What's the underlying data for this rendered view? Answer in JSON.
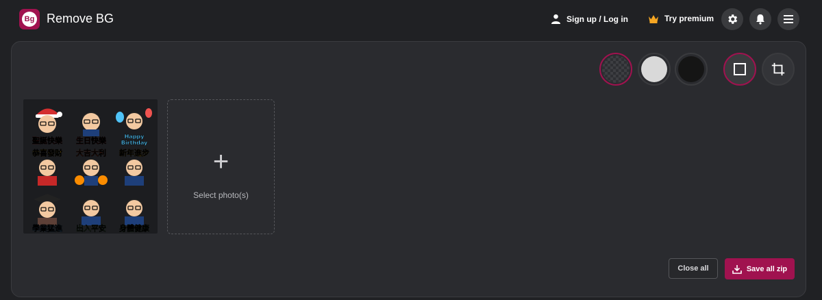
{
  "header": {
    "app_title": "Remove BG",
    "logo_text": "Bg",
    "signup_label": "Sign up / Log in",
    "premium_label": "Try premium",
    "icons": [
      "user-icon",
      "crown-icon",
      "gear-icon",
      "bell-icon",
      "menu-icon"
    ]
  },
  "toolbar": {
    "background_options": [
      "transparent",
      "light-gray",
      "black"
    ],
    "background_colors": {
      "light-gray": "#d9d9d9",
      "black": "#151515"
    },
    "selected_background": "transparent",
    "view_options": [
      "square-icon",
      "crop-icon"
    ],
    "selected_view": "square-icon",
    "accent_color": "#a0124f"
  },
  "images": {
    "stickers": [
      {
        "label": "聖誕快樂"
      },
      {
        "label": "生日快樂"
      },
      {
        "label": "Happy Birthday"
      },
      {
        "label": "恭喜發財"
      },
      {
        "label": "大吉大利"
      },
      {
        "label": "新年進步"
      },
      {
        "label": "學業猛進"
      },
      {
        "label": "出入平安"
      },
      {
        "label": "身體健康"
      }
    ]
  },
  "add_photo": {
    "plus": "+",
    "label": "Select photo(s)"
  },
  "actions": {
    "close_all_label": "Close all",
    "save_all_label": "Save all zip"
  }
}
